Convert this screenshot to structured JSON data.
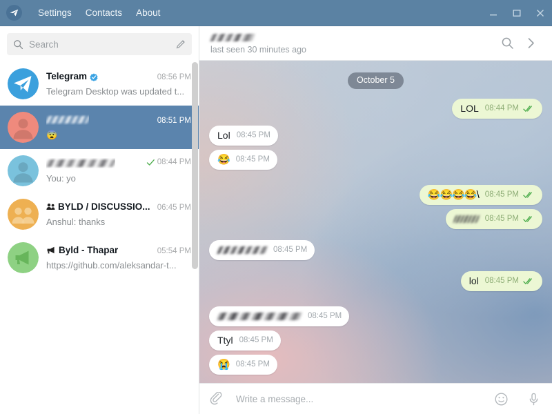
{
  "window": {
    "titlebar_color": "#5b82a3",
    "menu": [
      {
        "label": "Settings",
        "name": "menu-settings"
      },
      {
        "label": "Contacts",
        "name": "menu-contacts"
      },
      {
        "label": "About",
        "name": "menu-about"
      }
    ],
    "controls": {
      "minimize": "minimize-icon",
      "maximize": "maximize-icon",
      "close": "close-icon"
    },
    "app_logo": "telegram-logo-icon"
  },
  "sidebar": {
    "search": {
      "placeholder": "Search",
      "value": "",
      "icon": "search-icon",
      "compose_icon": "pencil-icon"
    },
    "chats": [
      {
        "name": "Telegram",
        "name_redacted": false,
        "verified": true,
        "time": "08:56 PM",
        "preview": "Telegram Desktop was updated t...",
        "preview_prefix": "",
        "avatar_color": "#3ba0dd",
        "avatar_kind": "telegram",
        "selected": false,
        "outgoing_tick": false,
        "type_icon": ""
      },
      {
        "name": "",
        "name_redacted": true,
        "redacted_width": 62,
        "verified": false,
        "time": "08:51 PM",
        "preview": "😨",
        "preview_prefix": "",
        "avatar_color": "#ef8a7d",
        "avatar_kind": "person",
        "selected": true,
        "outgoing_tick": false,
        "type_icon": ""
      },
      {
        "name": "",
        "name_redacted": true,
        "redacted_width": 100,
        "verified": false,
        "time": "08:44 PM",
        "preview": "You: yo",
        "preview_prefix": "",
        "avatar_color": "#7ac2dd",
        "avatar_kind": "person",
        "selected": false,
        "outgoing_tick": true,
        "type_icon": ""
      },
      {
        "name": "BYLD / DISCUSSIO...",
        "name_redacted": false,
        "verified": false,
        "time": "06:45 PM",
        "preview": "Anshul: thanks",
        "preview_prefix": "",
        "avatar_color": "#eeb052",
        "avatar_kind": "group",
        "selected": false,
        "outgoing_tick": false,
        "type_icon": "group-icon"
      },
      {
        "name": "Byld - Thapar",
        "name_redacted": false,
        "verified": false,
        "time": "05:54 PM",
        "preview": "https://github.com/aleksandar-t...",
        "preview_prefix": "",
        "avatar_color": "#8ed183",
        "avatar_kind": "channel",
        "selected": false,
        "outgoing_tick": false,
        "type_icon": "megaphone-icon"
      }
    ]
  },
  "chat_header": {
    "title_redacted": true,
    "title": "",
    "status": "last seen 30 minutes ago",
    "search_icon": "search-icon",
    "more_icon": "chevron-right-icon"
  },
  "conversation": {
    "date_divider": "October 5",
    "messages": [
      {
        "side": "out",
        "kind": "text",
        "text": "LOL",
        "time": "08:44 PM",
        "ticks": "double-check"
      },
      {
        "side": "in",
        "kind": "text",
        "text": "Lol",
        "time": "08:45 PM",
        "ticks": ""
      },
      {
        "side": "in",
        "kind": "emoji",
        "text": "😂",
        "time": "08:45 PM",
        "ticks": ""
      },
      {
        "side": "out",
        "kind": "emoji",
        "text": "😂😂😂😂\\",
        "time": "08:45 PM",
        "ticks": "double-check"
      },
      {
        "side": "out",
        "kind": "redacted",
        "text": "",
        "time": "08:45 PM",
        "ticks": "double-check",
        "redacted_width": 36
      },
      {
        "side": "in",
        "kind": "redacted",
        "text": "",
        "time": "08:45 PM",
        "ticks": "",
        "redacted_width": 72
      },
      {
        "side": "out",
        "kind": "text",
        "text": "lol",
        "time": "08:45 PM",
        "ticks": "double-check"
      },
      {
        "side": "in",
        "kind": "redacted",
        "text": "",
        "time": "08:45 PM",
        "ticks": "",
        "redacted_width": 122
      },
      {
        "side": "in",
        "kind": "text",
        "text": "Ttyl",
        "time": "08:45 PM",
        "ticks": ""
      },
      {
        "side": "in",
        "kind": "emoji",
        "text": "😭",
        "time": "08:45 PM",
        "ticks": ""
      }
    ]
  },
  "composer": {
    "attach_icon": "paperclip-icon",
    "placeholder": "Write a message...",
    "value": "",
    "emoji_icon": "smiley-icon",
    "mic_icon": "microphone-icon"
  },
  "colors": {
    "titlebar": "#5b82a3",
    "selection": "#5b84ad",
    "outgoing_bubble": "#ecf7d4",
    "incoming_bubble": "#ffffff",
    "tick_green": "#4fae4e",
    "verified_blue": "#3aa3e3"
  }
}
